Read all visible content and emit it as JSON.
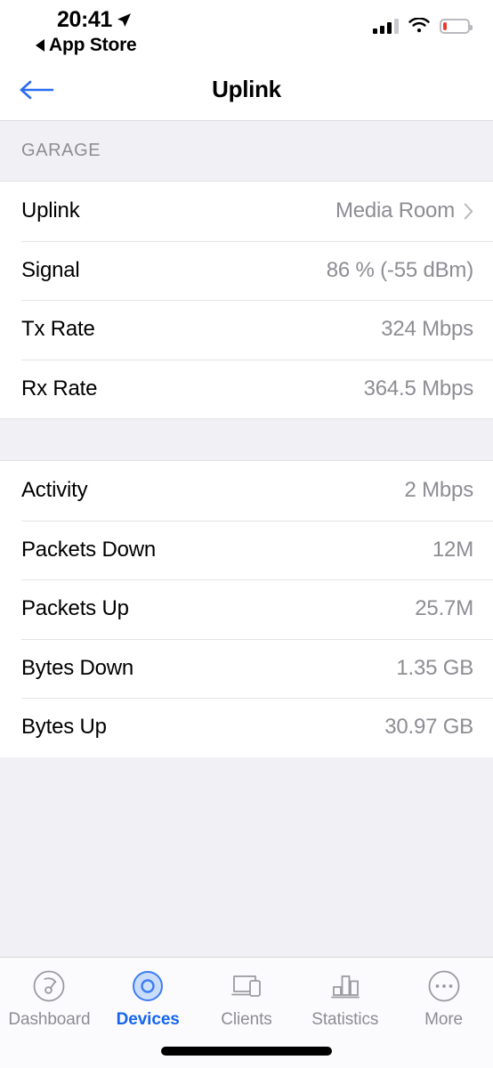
{
  "status_bar": {
    "time": "20:41",
    "location_icon": "location-arrow-icon",
    "back_to_app": "App Store",
    "cellular_bars_filled": 3,
    "cellular_bars_total": 4,
    "wifi_icon": "wifi-icon",
    "battery_level_percent": 15,
    "battery_color": "#ea3c2e"
  },
  "nav": {
    "back_icon": "back-arrow-icon",
    "title": "Uplink",
    "accent_color": "#1565f0"
  },
  "sections": [
    {
      "header": "GARAGE",
      "rows": [
        {
          "label": "Uplink",
          "value": "Media Room",
          "chevron": true
        },
        {
          "label": "Signal",
          "value": "86 % (-55 dBm)",
          "chevron": false
        },
        {
          "label": "Tx Rate",
          "value": "324 Mbps",
          "chevron": false
        },
        {
          "label": "Rx Rate",
          "value": "364.5 Mbps",
          "chevron": false
        }
      ]
    },
    {
      "header": "",
      "rows": [
        {
          "label": "Activity",
          "value": "2 Mbps",
          "chevron": false
        },
        {
          "label": "Packets Down",
          "value": "12M",
          "chevron": false
        },
        {
          "label": "Packets Up",
          "value": "25.7M",
          "chevron": false
        },
        {
          "label": "Bytes Down",
          "value": "1.35 GB",
          "chevron": false
        },
        {
          "label": "Bytes Up",
          "value": "30.97 GB",
          "chevron": false
        }
      ]
    }
  ],
  "tabbar": {
    "items": [
      {
        "label": "Dashboard",
        "icon": "gauge-icon",
        "active": false
      },
      {
        "label": "Devices",
        "icon": "device-ring-icon",
        "active": true
      },
      {
        "label": "Clients",
        "icon": "clients-icon",
        "active": false
      },
      {
        "label": "Statistics",
        "icon": "bar-chart-icon",
        "active": false
      },
      {
        "label": "More",
        "icon": "ellipsis-icon",
        "active": false
      }
    ],
    "active_color": "#1565f0",
    "inactive_color": "#8d8d93"
  }
}
